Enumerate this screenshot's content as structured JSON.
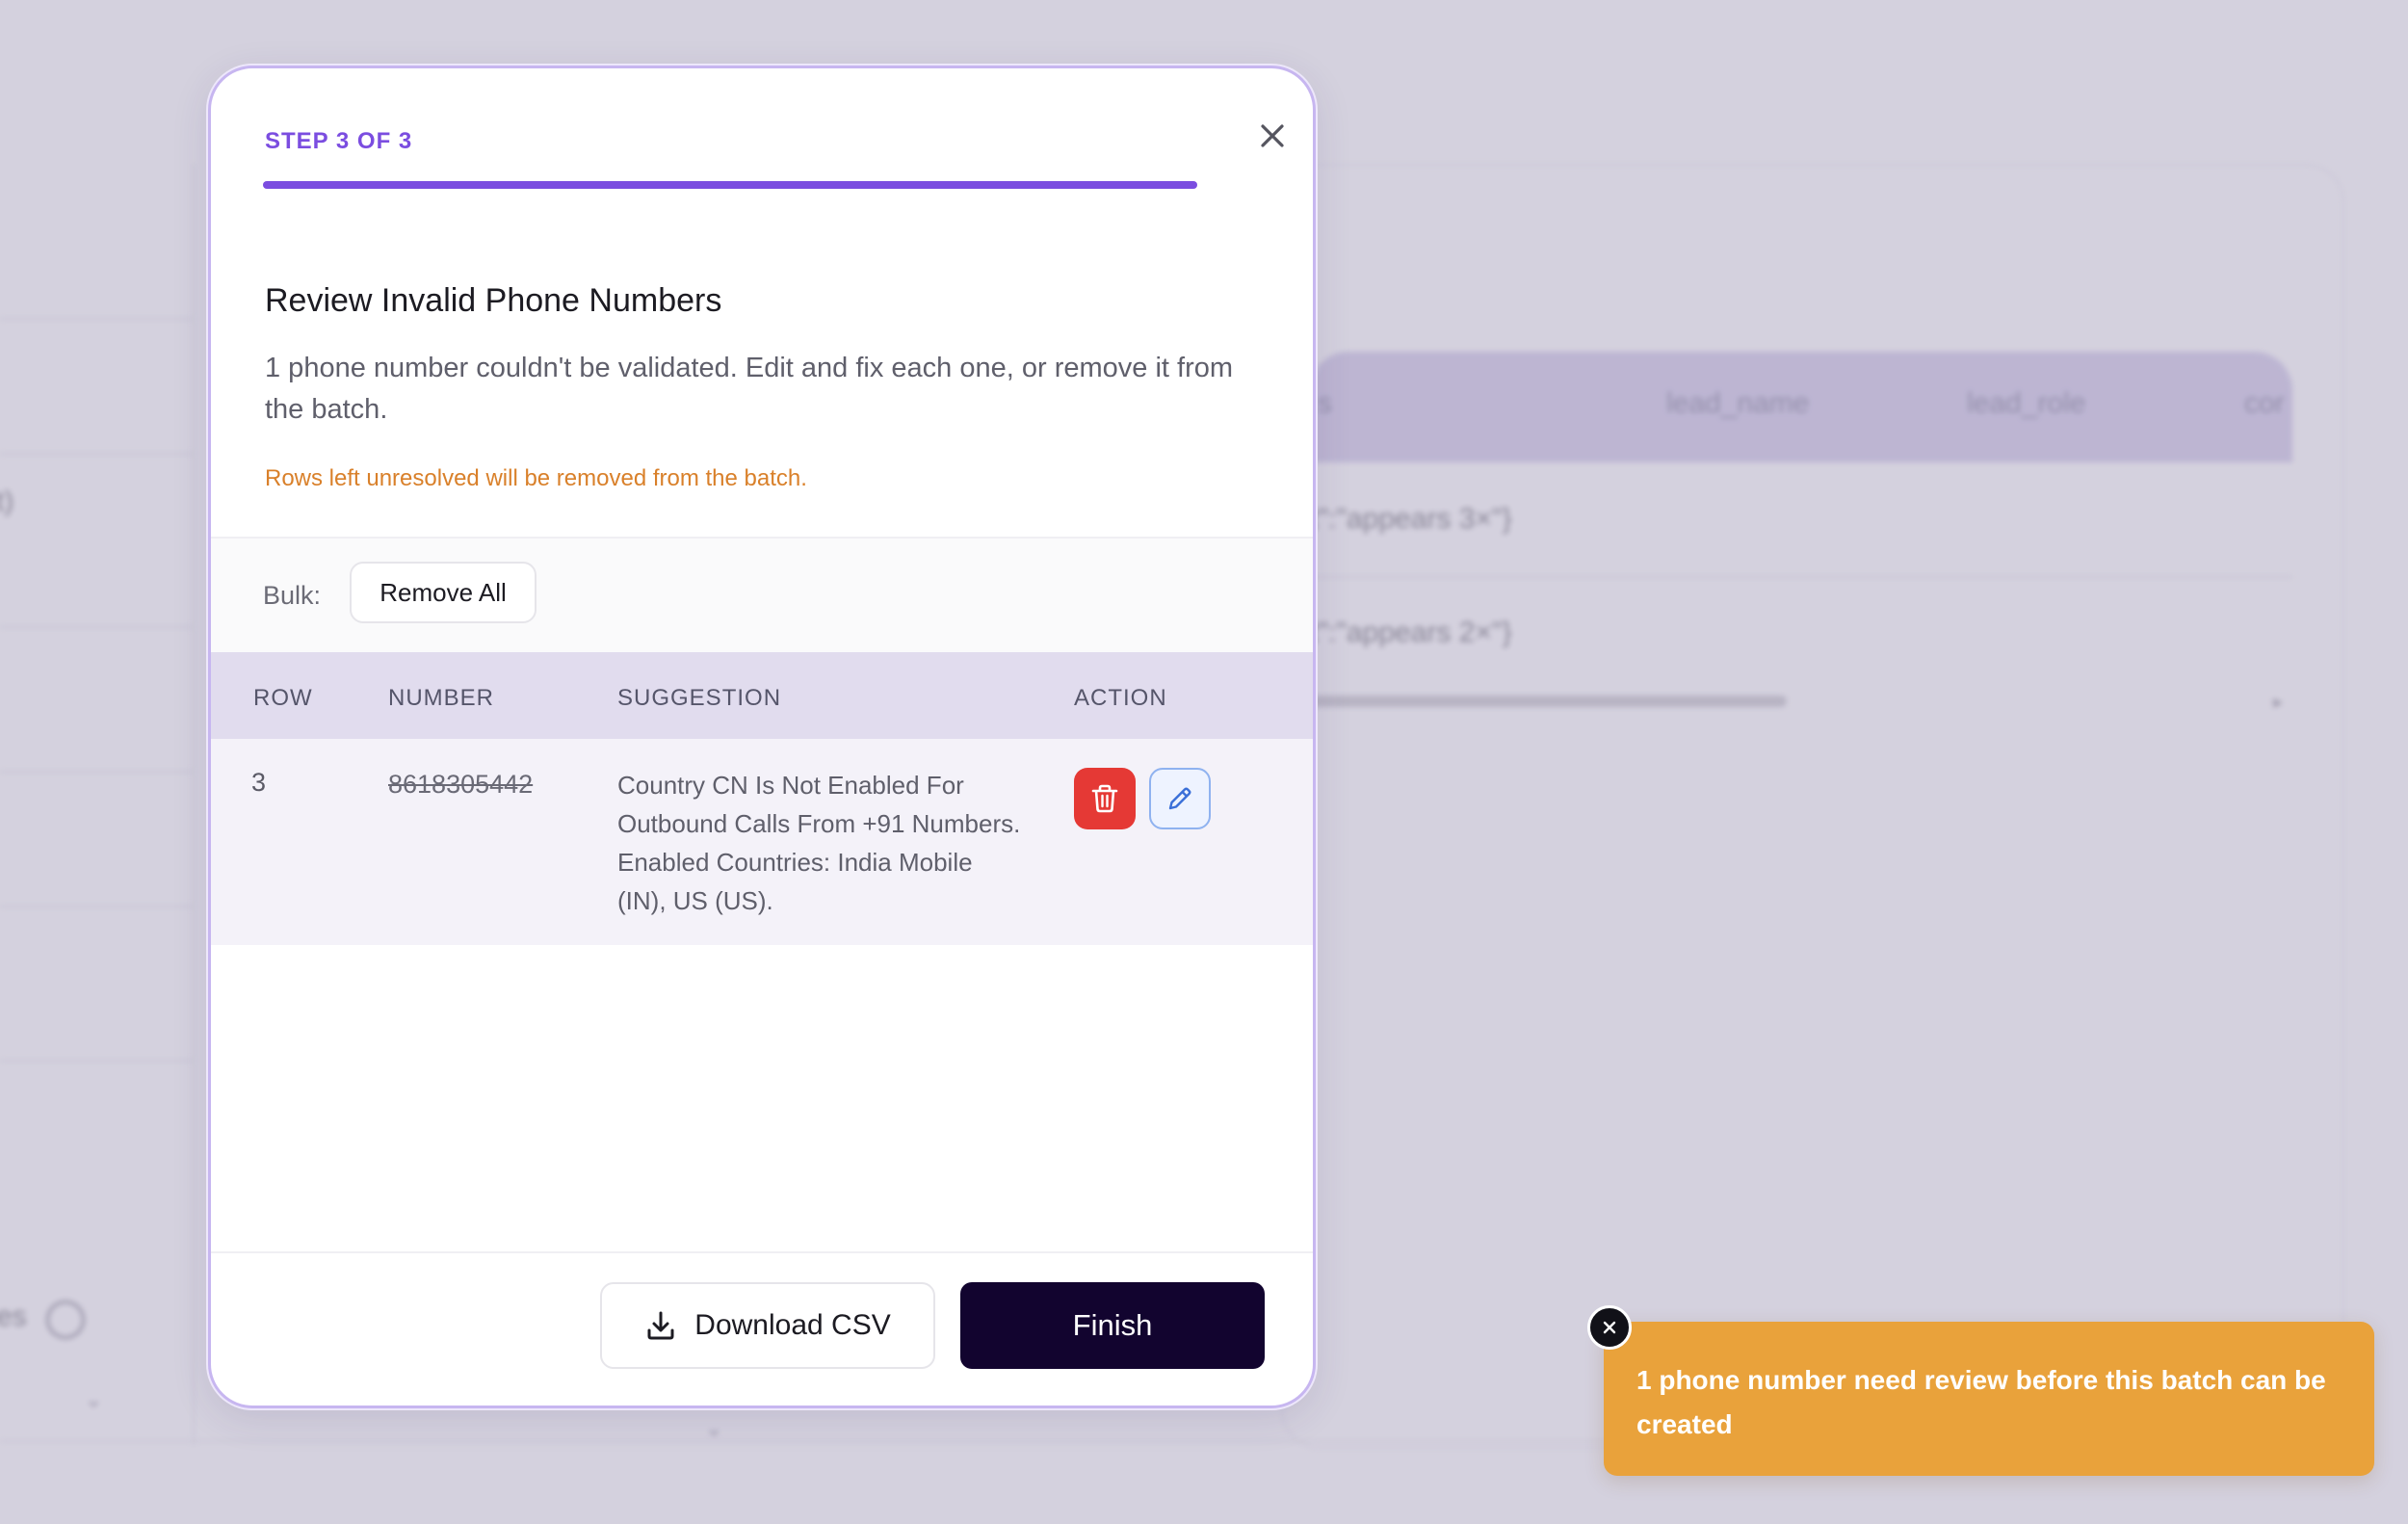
{
  "background": {
    "table_headers": [
      "s",
      "lead_name",
      "lead_role",
      "cor"
    ],
    "rows": [
      "t\":\"appears 3×\"}",
      "t\":\"appears 2×\"}"
    ],
    "left_text": "t)",
    "left_text_2": "es"
  },
  "modal": {
    "step_label": "STEP 3 OF 3",
    "progress": 1.0,
    "title": "Review Invalid Phone Numbers",
    "description": "1 phone number couldn't be validated. Edit and fix each one, or remove it from the batch.",
    "warning": "Rows left unresolved will be removed from the batch.",
    "bulk": {
      "label": "Bulk:",
      "remove_all_label": "Remove All"
    },
    "table": {
      "headers": {
        "row": "ROW",
        "number": "NUMBER",
        "suggestion": "SUGGESTION",
        "action": "ACTION"
      },
      "rows": [
        {
          "row": "3",
          "number": "8618305442",
          "suggestion": "Country CN Is Not Enabled For Outbound Calls From +91 Numbers. Enabled Countries: India Mobile (IN), US (US)."
        }
      ]
    },
    "footer": {
      "download_label": "Download CSV",
      "finish_label": "Finish"
    }
  },
  "toast": {
    "message": "1 phone number need review before this batch can be created"
  },
  "colors": {
    "accent": "#7b4de0",
    "warning_text": "#d9802a",
    "delete_button": "#e53935",
    "finish_button": "#12042f",
    "toast_background": "#e9a23b"
  },
  "icons": {
    "close": "close-icon",
    "delete": "trash-icon",
    "edit": "pencil-icon",
    "download": "download-icon",
    "toast_close": "close-icon",
    "background_info": "info-icon",
    "background_chevron": "chevron-down-icon"
  }
}
